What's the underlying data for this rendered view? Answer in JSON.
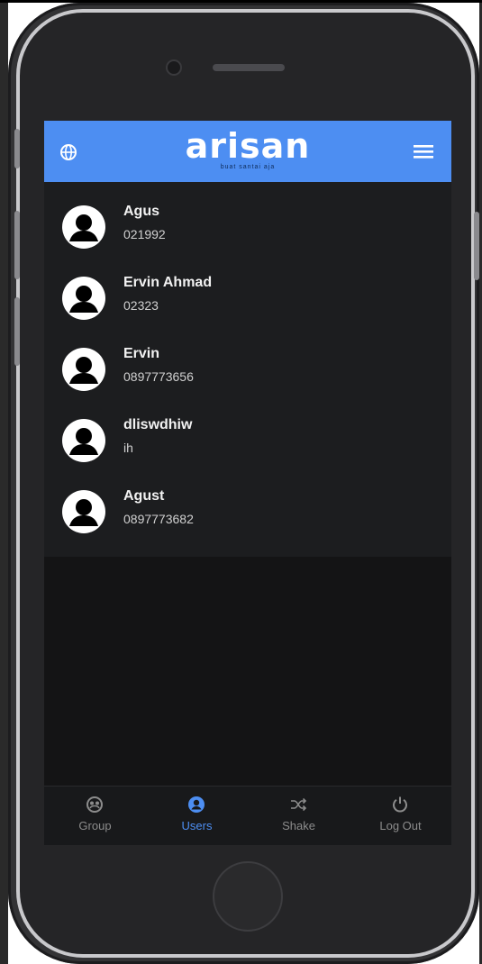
{
  "app": {
    "logo": "arisan",
    "tagline": "buat santai aja"
  },
  "users": [
    {
      "name": "Agus",
      "phone": "021992"
    },
    {
      "name": "Ervin Ahmad",
      "phone": "02323"
    },
    {
      "name": "Ervin",
      "phone": "0897773656"
    },
    {
      "name": "dliswdhiw",
      "phone": "ih"
    },
    {
      "name": "Agust",
      "phone": "0897773682"
    }
  ],
  "nav": [
    {
      "label": "Group",
      "icon": "group-icon",
      "active": false
    },
    {
      "label": "Users",
      "icon": "user-icon",
      "active": true
    },
    {
      "label": "Shake",
      "icon": "shuffle-icon",
      "active": false
    },
    {
      "label": "Log Out",
      "icon": "power-icon",
      "active": false
    }
  ],
  "colors": {
    "accent": "#4d8ef2",
    "header_bg": "#4d8ef2",
    "list_bg": "#1c1d1f",
    "screen_bg": "#141415",
    "inactive_nav": "#8c8c8c"
  }
}
